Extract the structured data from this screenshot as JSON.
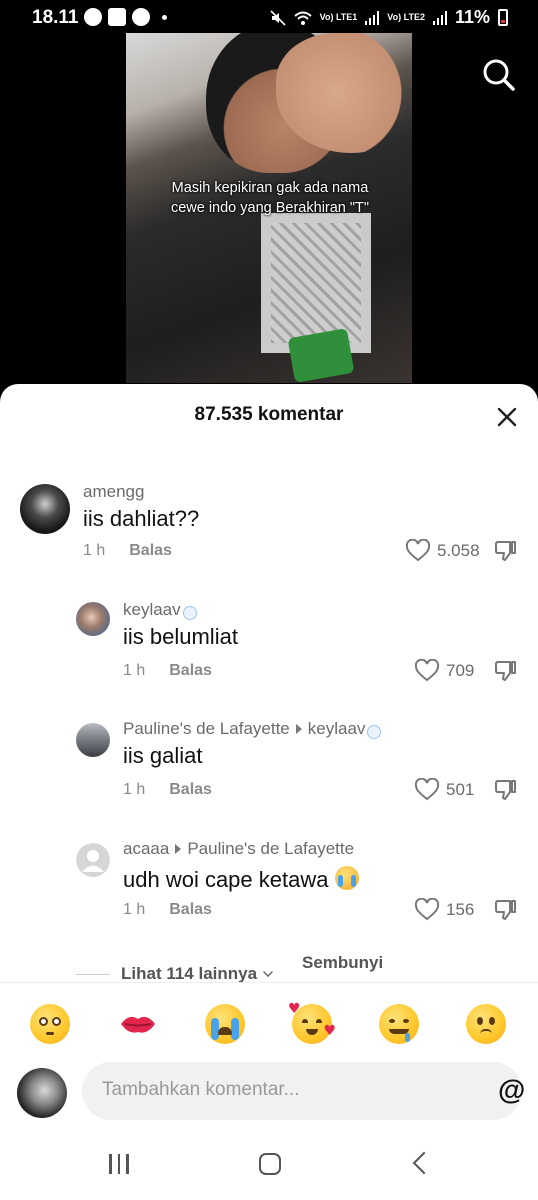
{
  "status_bar": {
    "time": "18.11",
    "battery": "11%",
    "sim1_label": "Vo) LTE1",
    "sim2_label": "Vo) LTE2"
  },
  "video": {
    "caption": "Masih kepikiran gak ada nama cewe indo yang Berakhiran \"T\""
  },
  "sheet": {
    "title": "87.535 komentar"
  },
  "comments": [
    {
      "user": "amengg",
      "reply_to": "",
      "text": "iis dahliat??",
      "time": "1 h",
      "reply_label": "Balas",
      "likes": "5.058"
    },
    {
      "user": "keylaav",
      "reply_to": "",
      "text": "iis belumliat",
      "time": "1 h",
      "reply_label": "Balas",
      "likes": "709"
    },
    {
      "user": "Pauline's de Lafayette",
      "reply_to": "keylaav",
      "text": "iis galiat",
      "time": "1 h",
      "reply_label": "Balas",
      "likes": "501"
    },
    {
      "user": "acaaa",
      "reply_to": "Pauline's de Lafayette",
      "text": "udh woi cape ketawa",
      "time": "1 h",
      "reply_label": "Balas",
      "likes": "156"
    }
  ],
  "more_replies": {
    "view_more": "Lihat 114 lainnya",
    "hide": "Sembunyikan"
  },
  "emoji_bar": [
    "flushed-face",
    "kiss-mark",
    "loudly-crying-face",
    "smiling-face-with-hearts",
    "drooling-face",
    "slightly-frowning-face"
  ],
  "comment_input": {
    "placeholder": "Tambahkan komentar..."
  },
  "colors": {
    "accent_like": "#6b6b6b",
    "sheet_bg": "#ffffff",
    "input_bg": "#f1f1f2"
  }
}
